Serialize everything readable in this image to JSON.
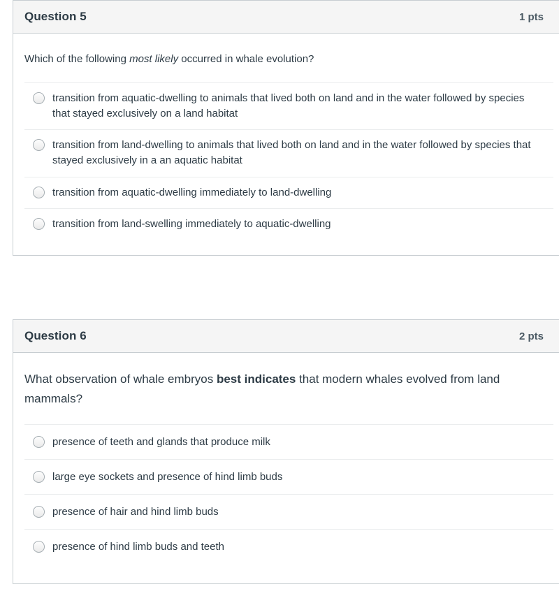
{
  "questions": [
    {
      "title": "Question 5",
      "points": "1 pts",
      "prompt_parts": {
        "before": "Which of the following ",
        "emphasis": "most likely",
        "after": " occurred in whale evolution?"
      },
      "prompt_text": "Which of the following most likely occurred in whale evolution?",
      "options": [
        "transition from aquatic-dwelling to animals that lived both on land and in the water followed by species that stayed exclusively on a land habitat",
        "transition from land-dwelling to animals that lived both on land and in the water followed by species that stayed exclusively in a an aquatic habitat",
        "transition from aquatic-dwelling immediately to land-dwelling",
        "transition from land-swelling immediately to aquatic-dwelling"
      ]
    },
    {
      "title": "Question 6",
      "points": "2 pts",
      "prompt_parts": {
        "before": "What observation of whale embryos ",
        "emphasis": "best indicates",
        "after": " that modern whales evolved from land mammals?"
      },
      "prompt_text": "What observation of whale embryos best indicates that modern whales evolved from land mammals?",
      "options": [
        "presence of teeth and glands that produce milk",
        "large eye sockets and presence of hind limb buds",
        "presence of hair and hind limb buds",
        "presence of hind limb buds and teeth"
      ]
    }
  ],
  "colors": {
    "header_background": "#f5f5f5",
    "card_border": "#c7cdd1",
    "text": "#2d3b45",
    "separator": "#ebedee",
    "radio_border": "#a6aeb3"
  }
}
